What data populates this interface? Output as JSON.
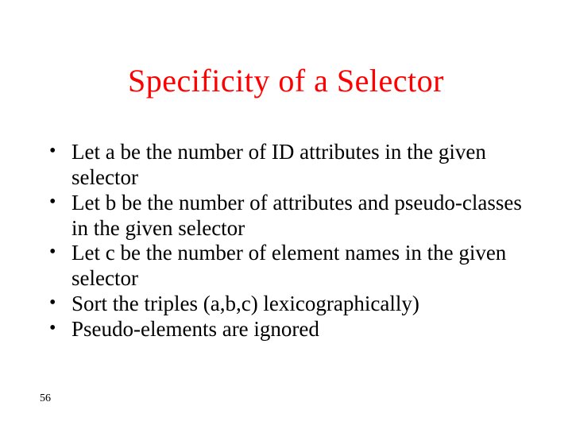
{
  "title": "Specificity of a Selector",
  "bullets": [
    "Let a be the number of ID attributes in the given selector",
    "Let b be the number of attributes and pseudo-classes in the given selector",
    "Let c be the number of element names in the given selector",
    "Sort the triples (a,b,c) lexicographically)",
    "Pseudo-elements are ignored"
  ],
  "bullet_mark": "•",
  "page_number": "56"
}
